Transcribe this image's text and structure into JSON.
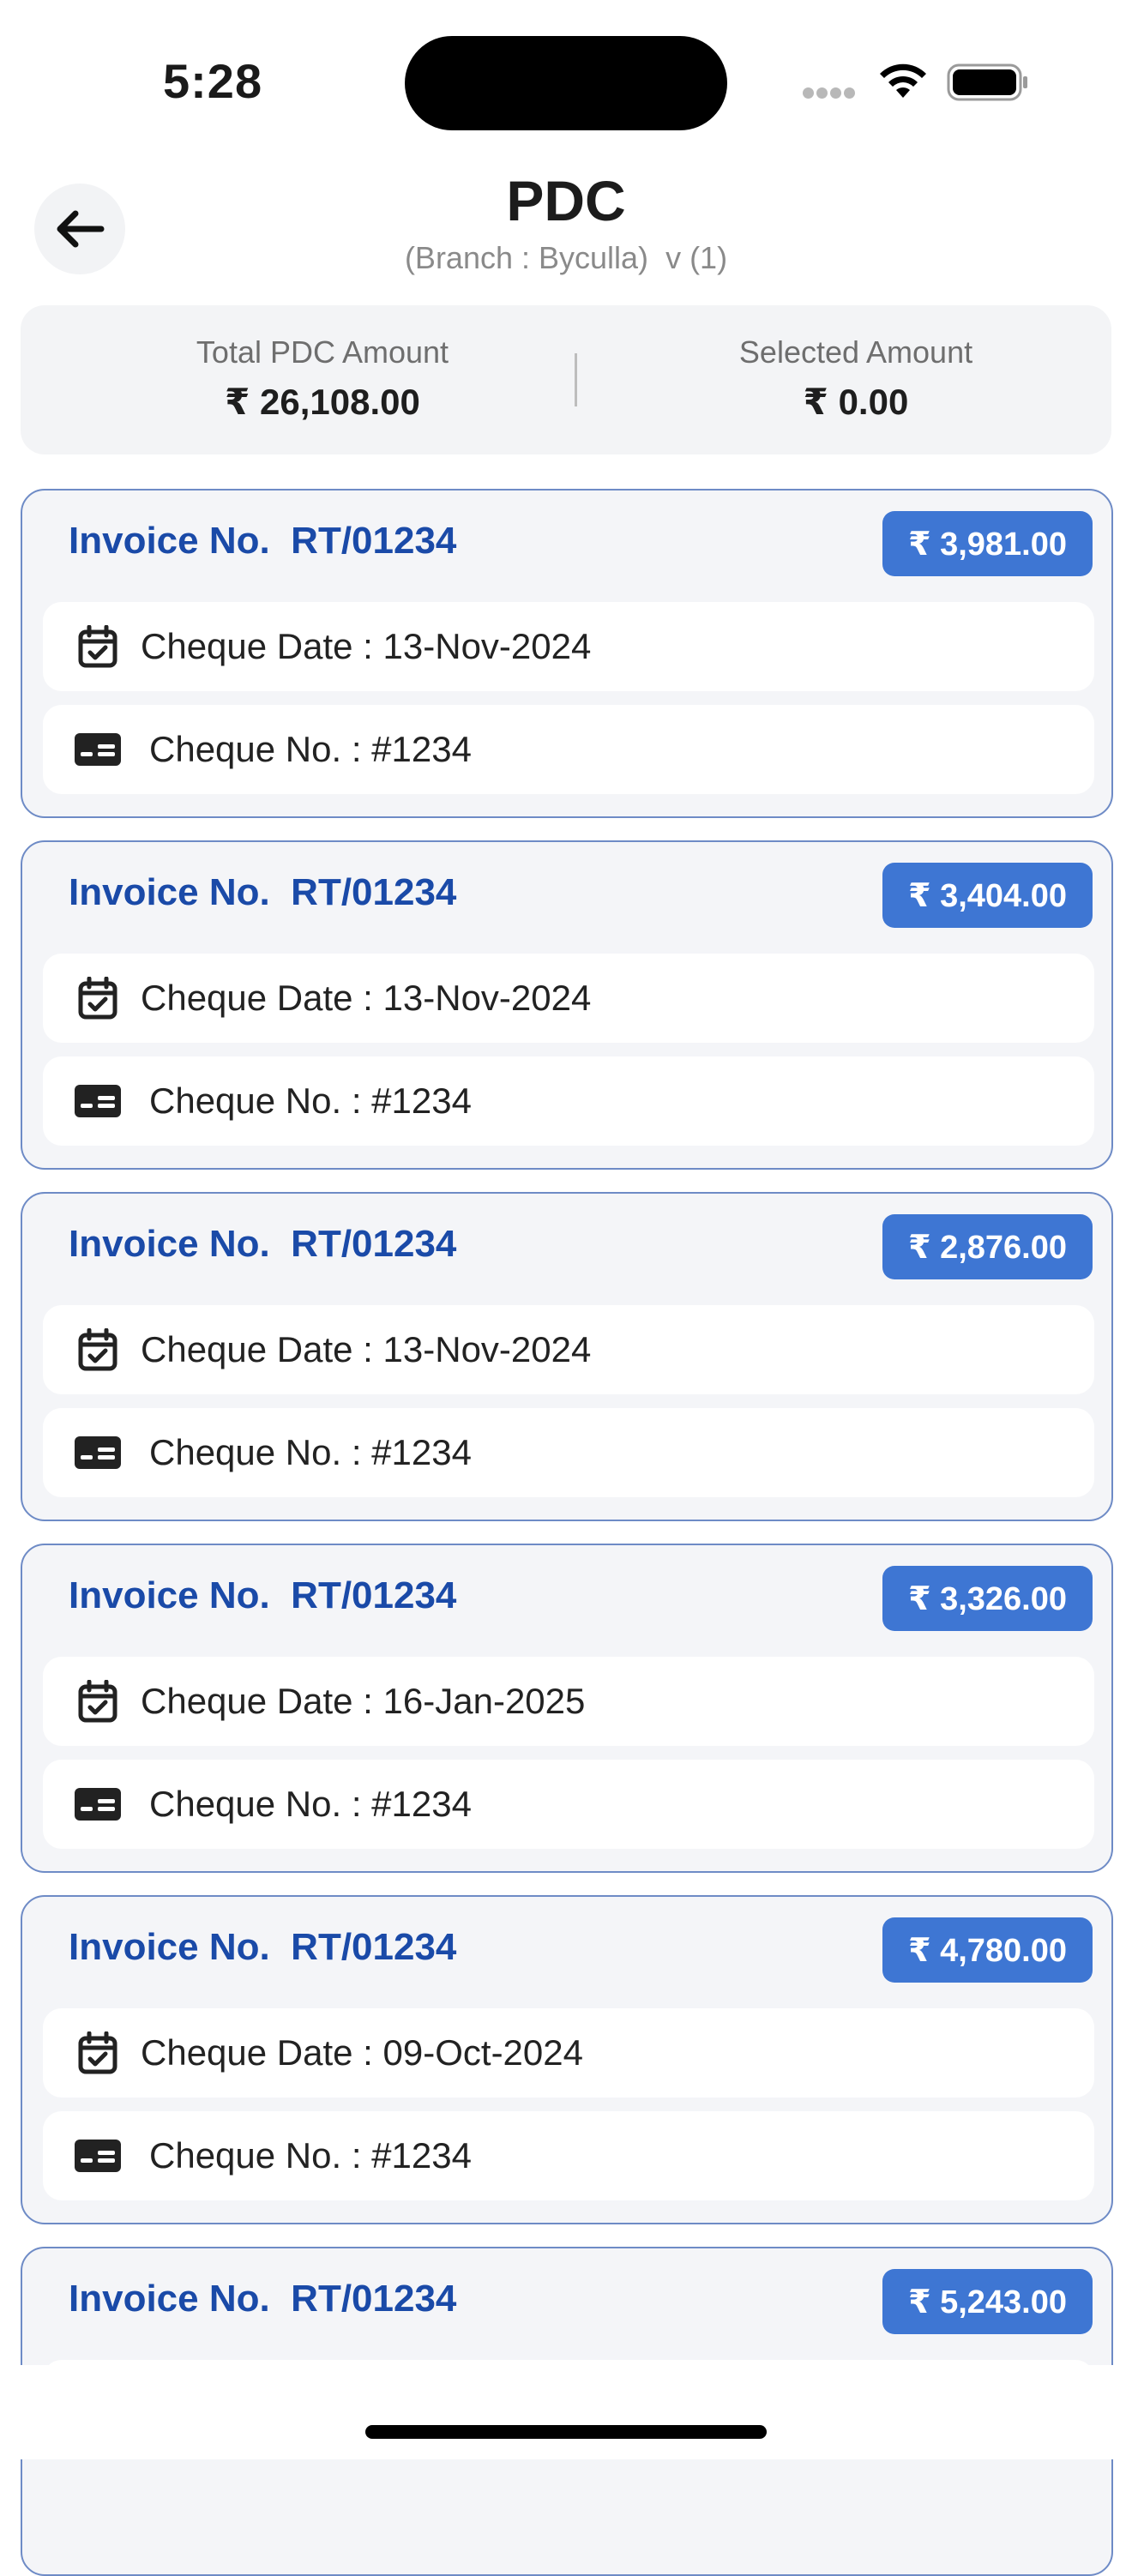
{
  "status_bar": {
    "time": "5:28"
  },
  "header": {
    "title": "PDC",
    "branch": "(Branch : Byculla)",
    "version": "v (1)"
  },
  "summary": {
    "total_label": "Total PDC Amount",
    "total_value": "₹ 26,108.00",
    "selected_label": "Selected Amount",
    "selected_value": "₹ 0.00"
  },
  "labels": {
    "invoice_prefix": "Invoice No.",
    "cheque_date_prefix": "Cheque Date :",
    "cheque_no_prefix": "Cheque No. :"
  },
  "invoices": [
    {
      "invoice_no": "RT/01234",
      "amount": "₹ 3,981.00",
      "cheque_date": "13-Nov-2024",
      "cheque_no": "#1234"
    },
    {
      "invoice_no": "RT/01234",
      "amount": "₹ 3,404.00",
      "cheque_date": "13-Nov-2024",
      "cheque_no": "#1234"
    },
    {
      "invoice_no": "RT/01234",
      "amount": "₹ 2,876.00",
      "cheque_date": "13-Nov-2024",
      "cheque_no": "#1234"
    },
    {
      "invoice_no": "RT/01234",
      "amount": "₹ 3,326.00",
      "cheque_date": "16-Jan-2025",
      "cheque_no": "#1234"
    },
    {
      "invoice_no": "RT/01234",
      "amount": "₹ 4,780.00",
      "cheque_date": "09-Oct-2024",
      "cheque_no": "#1234"
    },
    {
      "invoice_no": "RT/01234",
      "amount": "₹ 5,243.00"
    }
  ],
  "colors": {
    "accent": "#3e76d3",
    "invoice_text": "#1a4aa8",
    "card_border": "#6e8bc6",
    "card_bg": "#f4f5f8"
  },
  "icons": {
    "back": "arrow-left-icon",
    "date": "calendar-check-icon",
    "cheque": "card-icon"
  }
}
